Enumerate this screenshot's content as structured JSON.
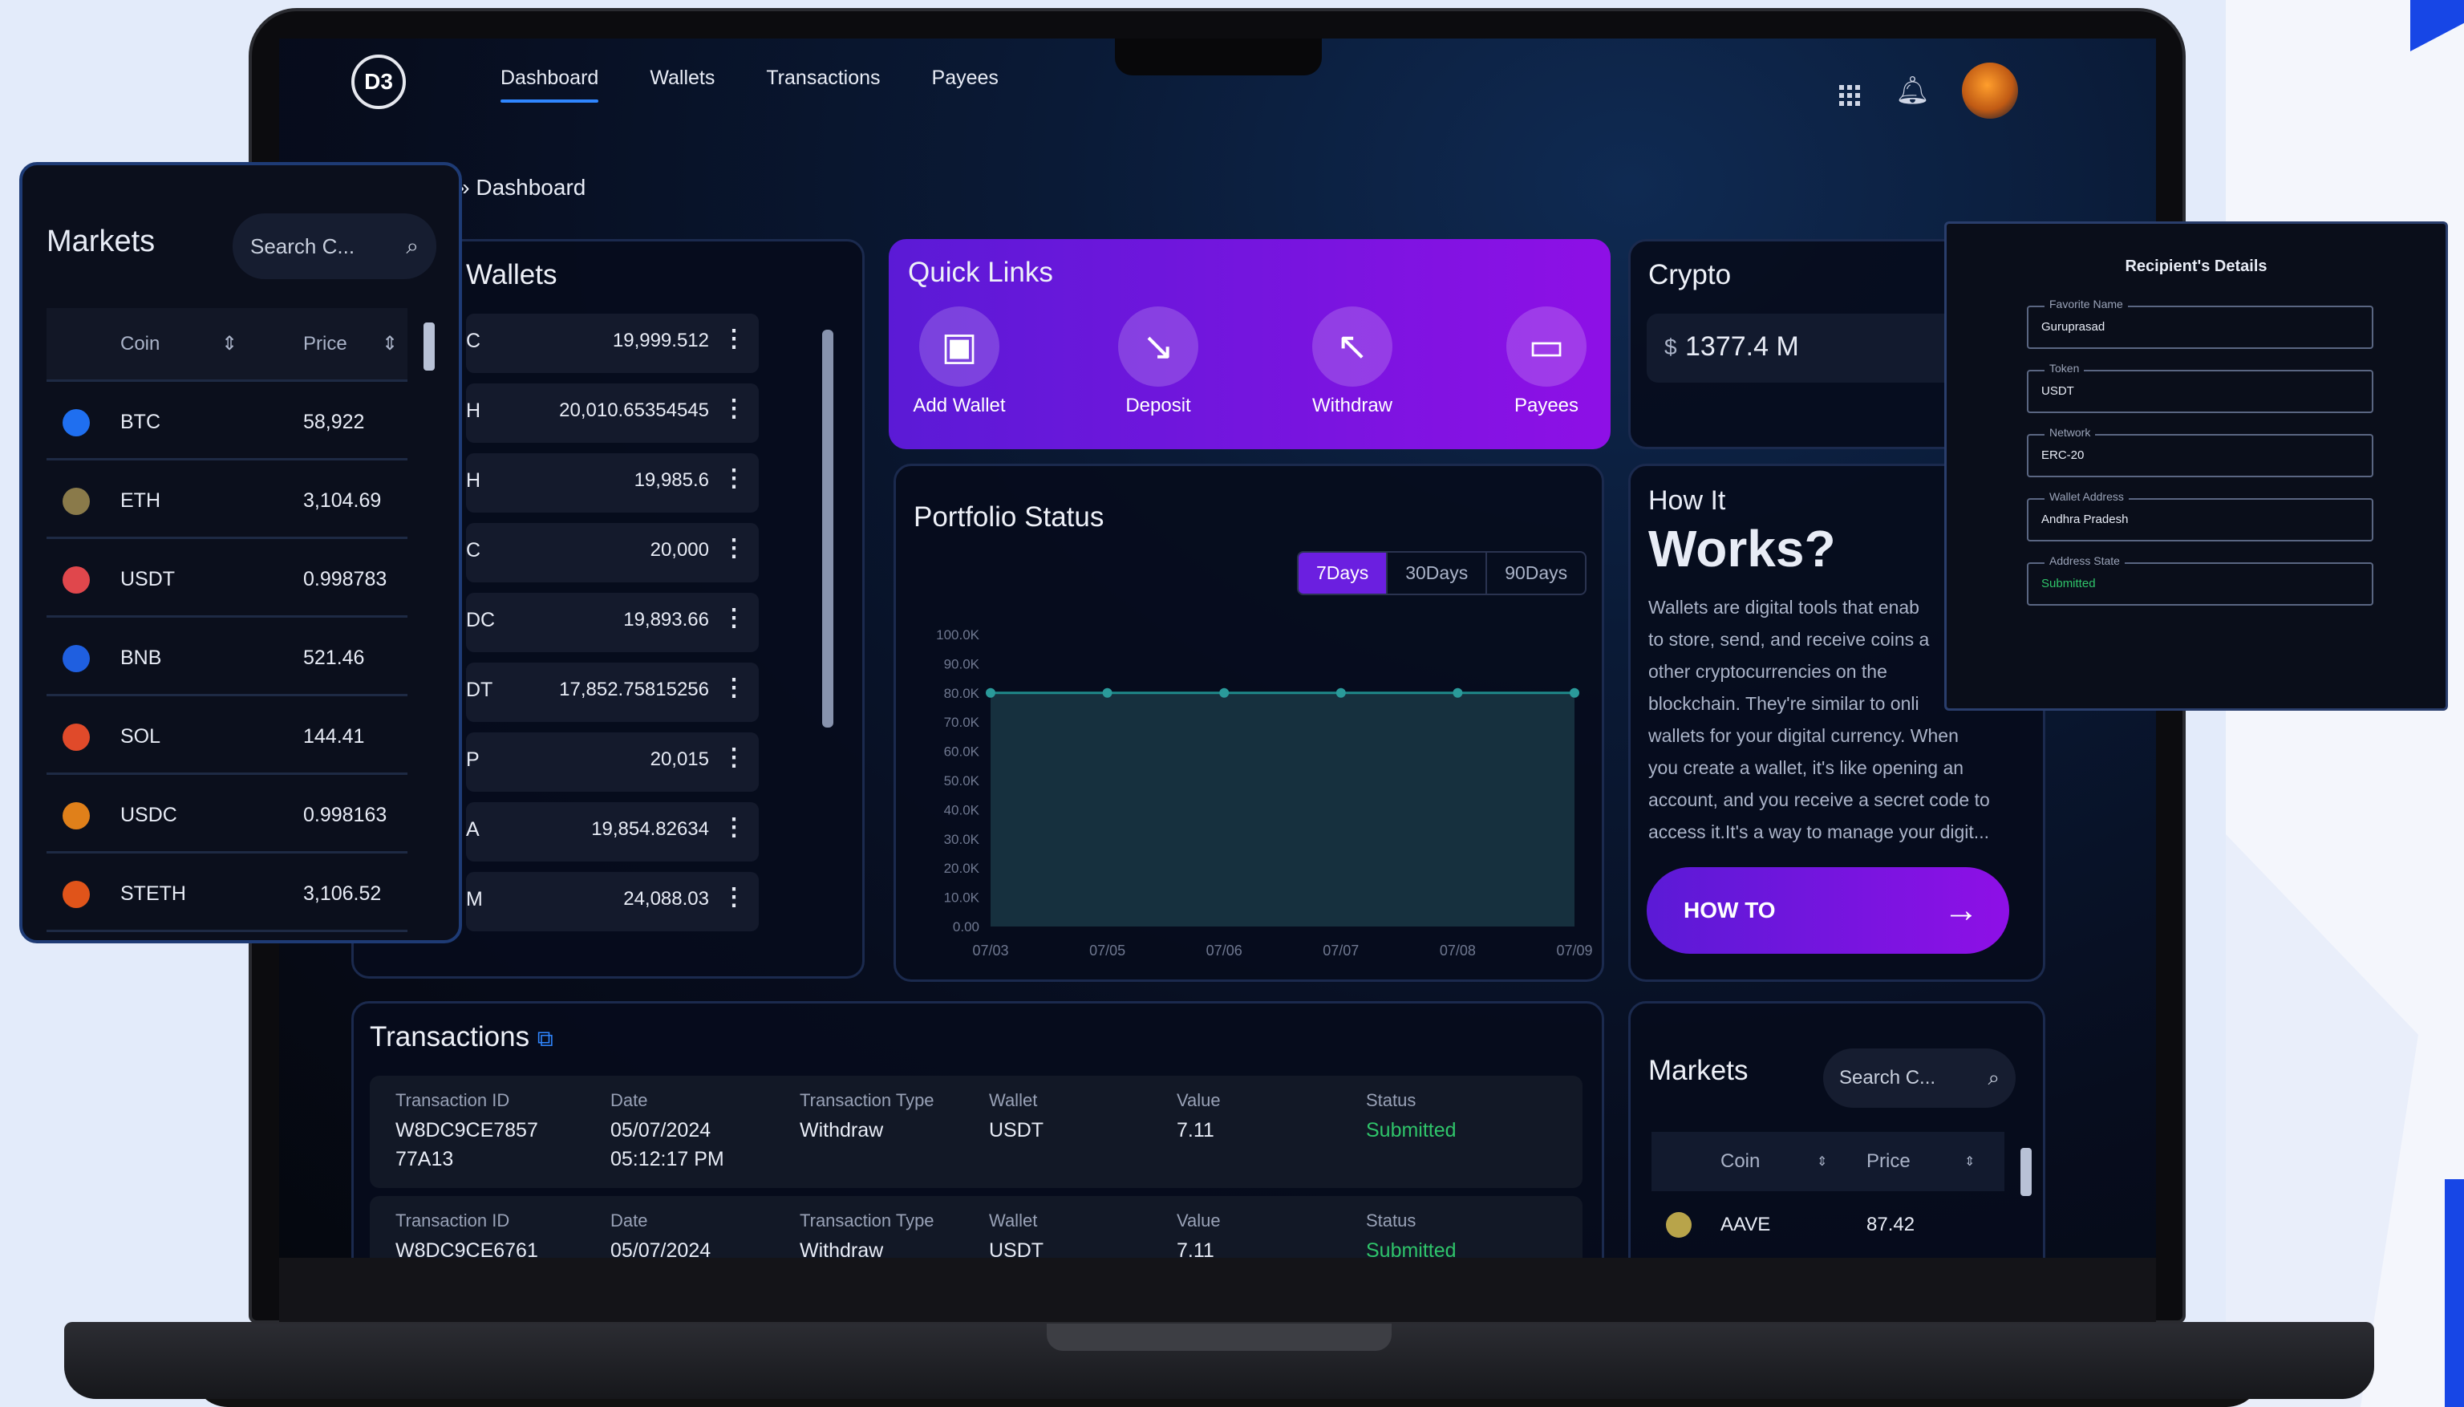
{
  "nav": {
    "items": [
      "Dashboard",
      "Wallets",
      "Transactions",
      "Payees"
    ]
  },
  "logo_text": "D3",
  "breadcrumb": "Dashboard",
  "wallets": {
    "title": "Wallets",
    "rows": [
      {
        "name": "C",
        "value": "19,999.512"
      },
      {
        "name": "H",
        "value": "20,010.65354545"
      },
      {
        "name": "H",
        "value": "19,985.6"
      },
      {
        "name": "C",
        "value": "20,000"
      },
      {
        "name": "DC",
        "value": "19,893.66"
      },
      {
        "name": "DT",
        "value": "17,852.75815256"
      },
      {
        "name": "P",
        "value": "20,015"
      },
      {
        "name": "A",
        "value": "19,854.82634"
      },
      {
        "name": "M",
        "value": "24,088.03"
      }
    ]
  },
  "quick_links": {
    "title": "Quick Links",
    "items": [
      "Add Wallet",
      "Deposit",
      "Withdraw",
      "Payees"
    ]
  },
  "crypto": {
    "title": "Crypto",
    "currency": "$",
    "amount": "1377.4 M"
  },
  "portfolio": {
    "title": "Portfolio Status",
    "ranges": [
      "7Days",
      "30Days",
      "90Days"
    ],
    "active_range": "7Days"
  },
  "chart_data": {
    "type": "area",
    "title": "Portfolio Status",
    "x": [
      "07/03",
      "07/05",
      "07/06",
      "07/07",
      "07/08",
      "07/09"
    ],
    "values": [
      80000,
      80000,
      80000,
      80000,
      80000,
      80000
    ],
    "yticks": [
      "100.0K",
      "90.0K",
      "80.0K",
      "70.0K",
      "60.0K",
      "50.0K",
      "40.0K",
      "30.0K",
      "20.0K",
      "10.0K",
      "0.00"
    ],
    "ylim": [
      0,
      100000
    ],
    "grid": false,
    "color": "#1f8a8a"
  },
  "how_it_works": {
    "line1": "How It",
    "line2": "Works?",
    "body_lines": [
      "Wallets are digital tools that enab",
      "to store, send, and receive coins a",
      "other cryptocurrencies on the",
      "blockchain. They're similar to onli",
      "wallets for your digital currency. When",
      "you create a wallet, it's like opening an",
      "account, and you receive a secret code to",
      "access it.It's a way to manage your digit..."
    ],
    "button": "HOW TO"
  },
  "transactions": {
    "title": "Transactions",
    "headers": [
      "Transaction ID",
      "Date",
      "Transaction Type",
      "Wallet",
      "Value",
      "Status"
    ],
    "rows": [
      {
        "id_1": "W8DC9CE7857",
        "id_2": "77A13",
        "date_1": "05/07/2024",
        "date_2": "05:12:17 PM",
        "type": "Withdraw",
        "wallet": "USDT",
        "value": "7.11",
        "status": "Submitted"
      },
      {
        "id_1": "W8DC9CE6761",
        "id_2": "",
        "date_1": "05/07/2024",
        "date_2": "",
        "type": "Withdraw",
        "wallet": "USDT",
        "value": "7.11",
        "status": "Submitted"
      }
    ],
    "status_color": "#2fc46a"
  },
  "markets_small": {
    "title": "Markets",
    "search_placeholder": "Search C...",
    "col_coin": "Coin",
    "col_price": "Price",
    "rows": [
      {
        "symbol": "AAVE",
        "price": "87.42"
      }
    ]
  },
  "markets_float": {
    "title": "Markets",
    "search_placeholder": "Search C...",
    "col_coin": "Coin",
    "col_price": "Price",
    "rows": [
      {
        "symbol": "BTC",
        "price": "58,922",
        "icon": "btc-icon",
        "color": "#1f6ff0"
      },
      {
        "symbol": "ETH",
        "price": "3,104.69",
        "icon": "eth-icon",
        "color": "#8a7a4a"
      },
      {
        "symbol": "USDT",
        "price": "0.998783",
        "icon": "usdt-icon",
        "color": "#e0474c"
      },
      {
        "symbol": "BNB",
        "price": "521.46",
        "icon": "bnb-icon",
        "color": "#1f5fe0"
      },
      {
        "symbol": "SOL",
        "price": "144.41",
        "icon": "sol-icon",
        "color": "#e04a2a"
      },
      {
        "symbol": "USDC",
        "price": "0.998163",
        "icon": "usdc-icon",
        "color": "#e0801a"
      },
      {
        "symbol": "STETH",
        "price": "3,106.52",
        "icon": "steth-icon",
        "color": "#e0541a"
      }
    ]
  },
  "recipient": {
    "title": "Recipient's Details",
    "fields": [
      {
        "label": "Favorite Name",
        "value": "Guruprasad"
      },
      {
        "label": "Token",
        "value": "USDT"
      },
      {
        "label": "Network",
        "value": "ERC-20"
      },
      {
        "label": "Wallet Address",
        "value": "Andhra Pradesh"
      },
      {
        "label": "Address State",
        "value": "Submitted"
      }
    ]
  }
}
